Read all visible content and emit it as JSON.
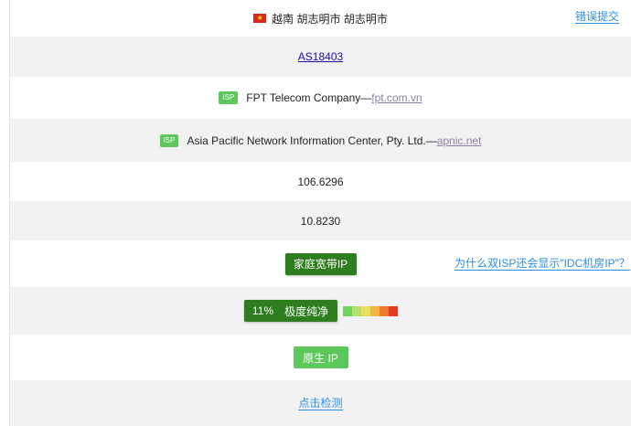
{
  "location": {
    "flag_icon": "vietnam-flag-icon",
    "text": "越南 胡志明市 胡志明市",
    "report_error": "错误提交"
  },
  "asn": {
    "label": "AS18403"
  },
  "isp_rows": [
    {
      "badge": "ISP",
      "name": "FPT Telecom Company— ",
      "domain": "fpt.com.vn"
    },
    {
      "badge": "ISP",
      "name": "Asia Pacific Network Information Center, Pty. Ltd.— ",
      "domain": "apnic.net"
    }
  ],
  "coordinates": {
    "longitude": "106.6296",
    "latitude": "10.8230"
  },
  "usage_type": {
    "label": "家庭宽带IP",
    "why_link": "为什么双ISP还会显示\"IDC机房IP\"？"
  },
  "fraud_score": {
    "percent": "11%",
    "label": "极度纯净",
    "scale_colors": [
      "#6fd25a",
      "#b4df6a",
      "#e9df5a",
      "#f3b540",
      "#ee7a32",
      "#e53b26"
    ]
  },
  "native_ip": {
    "label": "原生 IP"
  },
  "detect": {
    "label": "点击检测"
  },
  "colors": {
    "link": "#2b8ee6",
    "dark_green": "#2e7d1e",
    "green": "#5cc85c",
    "row_alt": "#f2f2f2"
  }
}
